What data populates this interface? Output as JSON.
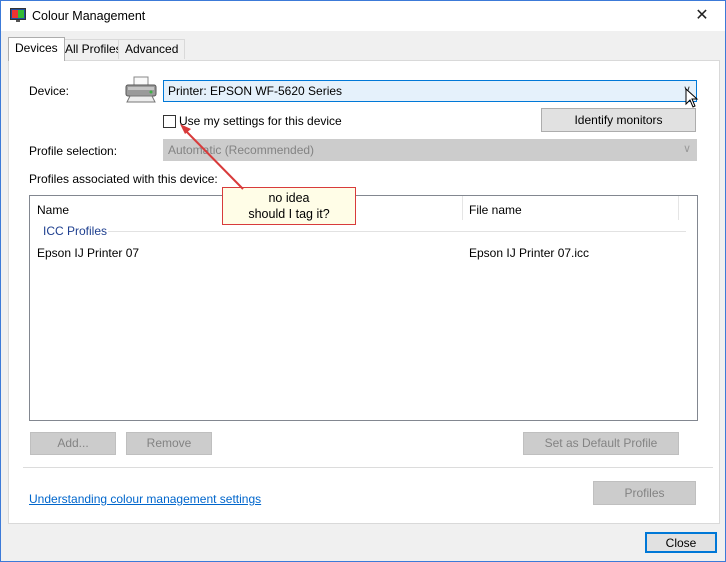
{
  "window": {
    "title": "Colour Management",
    "close_glyph": "✕"
  },
  "tabs": [
    {
      "label": "Devices",
      "active": true
    },
    {
      "label": "All Profiles",
      "active": false
    },
    {
      "label": "Advanced",
      "active": false
    }
  ],
  "device": {
    "label": "Device:",
    "selected": "Printer: EPSON WF-5620 Series",
    "use_settings_label": "Use my settings for this device",
    "use_settings_checked": false,
    "identify_monitors": "Identify monitors",
    "icon": "printer-icon"
  },
  "profile_selection": {
    "label": "Profile selection:",
    "value": "Automatic (Recommended)"
  },
  "profiles": {
    "label": "Profiles associated with this device:",
    "columns": [
      "Name",
      "File name"
    ],
    "group": "ICC Profiles",
    "rows": [
      {
        "name": "Epson IJ Printer 07",
        "file": "Epson IJ Printer 07.icc"
      }
    ]
  },
  "buttons": {
    "add": "Add...",
    "remove": "Remove",
    "set_default": "Set as Default Profile",
    "profiles": "Profiles",
    "close": "Close"
  },
  "link": "Understanding colour management settings",
  "annotation": {
    "line1": "no idea",
    "line2": "should I tag it?",
    "color": "#d83b3b"
  },
  "colors": {
    "accent": "#0078d7",
    "link": "#0066cc",
    "disabled": "#838383"
  }
}
